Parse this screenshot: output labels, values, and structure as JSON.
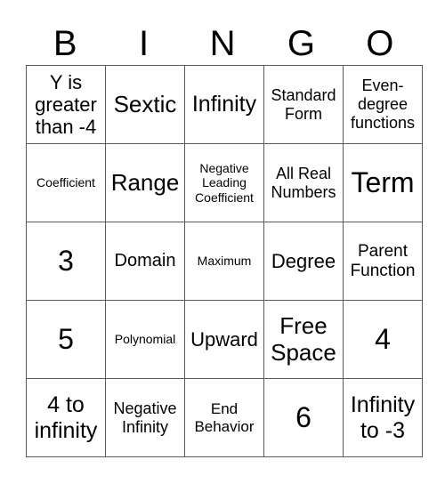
{
  "header": {
    "letters": [
      "B",
      "I",
      "N",
      "G",
      "O"
    ]
  },
  "rows": [
    [
      "Y is greater than -4",
      "Sextic",
      "Infinity",
      "Standard Form",
      "Even-degree functions"
    ],
    [
      "Coefficient",
      "Range",
      "Negative Leading Coefficient",
      "All Real Numbers",
      "Term"
    ],
    [
      "3",
      "Domain",
      "Maximum",
      "Degree",
      "Parent Function"
    ],
    [
      "5",
      "Polynomial",
      "Upward",
      "Free Space",
      "4"
    ],
    [
      "4 to infinity",
      "Negative Infinity",
      "End Behavior",
      "6",
      "Infinity to -3"
    ]
  ]
}
